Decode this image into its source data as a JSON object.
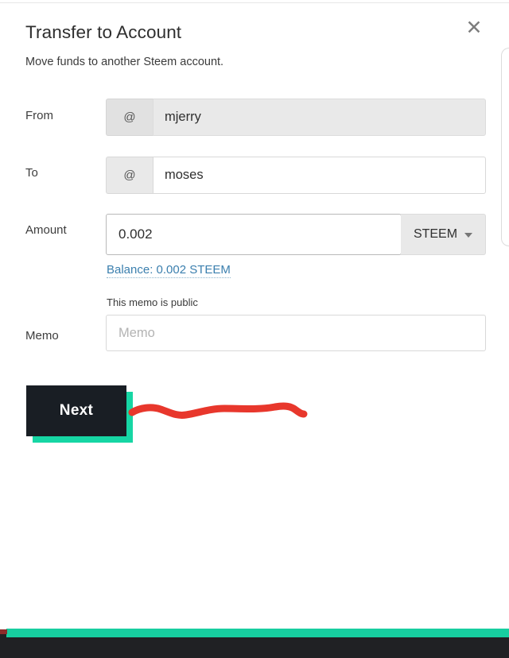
{
  "dialog": {
    "title": "Transfer to Account",
    "subtitle": "Move funds to another Steem account.",
    "close_label": "✕"
  },
  "form": {
    "from": {
      "label": "From",
      "prefix": "@",
      "value": "mjerry",
      "disabled": true
    },
    "to": {
      "label": "To",
      "prefix": "@",
      "value": "moses",
      "placeholder": "",
      "disabled": false
    },
    "amount": {
      "label": "Amount",
      "value": "0.002",
      "asset": "STEEM",
      "balance_text": "Balance: 0.002 STEEM"
    },
    "memo": {
      "label": "Memo",
      "note": "This memo is public",
      "value": "",
      "placeholder": "Memo"
    }
  },
  "actions": {
    "next_label": "Next"
  },
  "icons": {
    "close": "close-icon",
    "caret": "chevron-down-icon",
    "annotation": "red-squiggle-annotation"
  },
  "colors": {
    "accent_teal": "#16d6a4",
    "button_dark": "#191e24",
    "link_blue": "#3b7fae",
    "annotation_red": "#e8372c",
    "footer_dark": "#202124"
  }
}
